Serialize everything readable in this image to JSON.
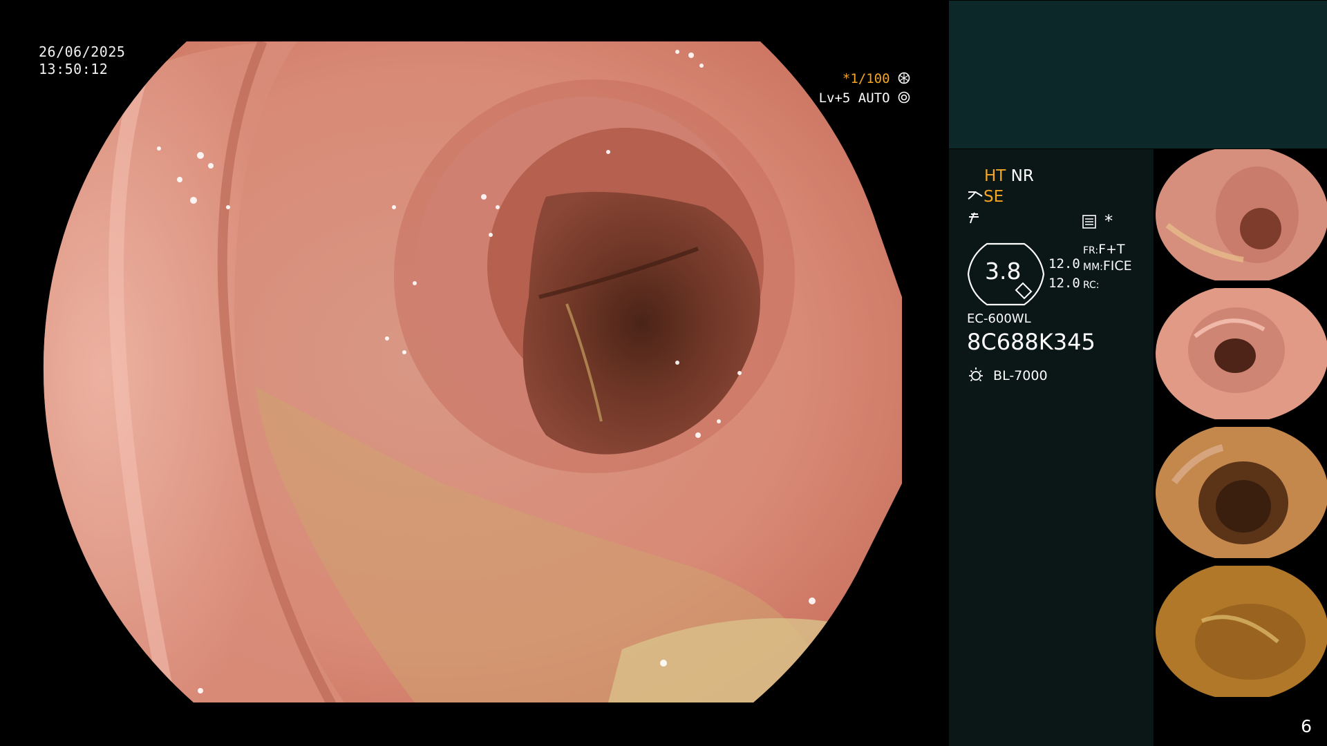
{
  "overlay": {
    "date": "26/06/2025",
    "time": "13:50:12",
    "shutter_prefix": "*",
    "shutter": "1/100",
    "level": "Lv+5",
    "mode": "AUTO"
  },
  "settings": {
    "ht": "HT",
    "nr": "NR",
    "se": "SE",
    "zoom_value": "3.8",
    "num1": "12.0",
    "num2": "12.0",
    "fr_label": "FR:",
    "fr_value": "F+T",
    "mm_label": "MM:",
    "mm_value": "FICE",
    "rc_label": "RC:",
    "scope_model": "EC-600WL",
    "serial": "8C688K345",
    "light_source": "BL-7000",
    "asterisk": "*"
  },
  "thumbnails": [
    {
      "name": "thumb-1"
    },
    {
      "name": "thumb-2"
    },
    {
      "name": "thumb-3"
    },
    {
      "name": "thumb-4"
    }
  ],
  "page_number": "6",
  "colors": {
    "accent_orange": "#f5a623",
    "panel_top": "#0c2828",
    "panel_info": "#0b1717"
  }
}
